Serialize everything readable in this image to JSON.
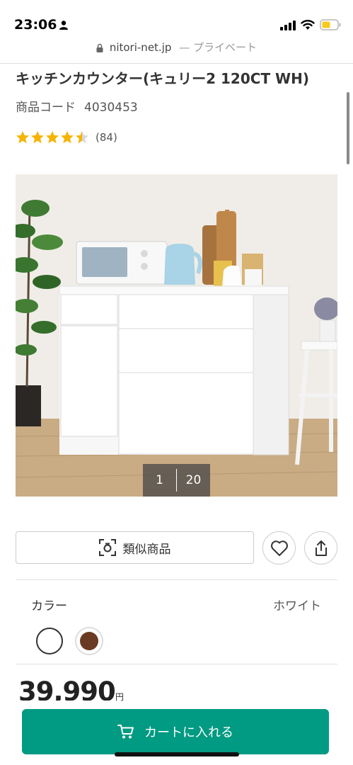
{
  "status_bar": {
    "time": "23:06"
  },
  "browser": {
    "domain": "nitori-net.jp",
    "privacy_label": "— プライベート"
  },
  "product": {
    "title": "キッチンカウンター(キュリー2 120CT WH)",
    "code_label": "商品コード",
    "code": "4030453",
    "rating": 4.5,
    "review_count": "(84)",
    "image_index": "1",
    "image_total": "20",
    "similar_button_label": "類似商品",
    "color_label": "カラー",
    "color_value": "ホワイト",
    "price": "39,990",
    "price_unit": "円"
  },
  "cart": {
    "button_label": "カートに入れる"
  },
  "colors": {
    "accent": "#019a82",
    "star": "#f5b400",
    "swatch_brown": "#6a3a22"
  }
}
